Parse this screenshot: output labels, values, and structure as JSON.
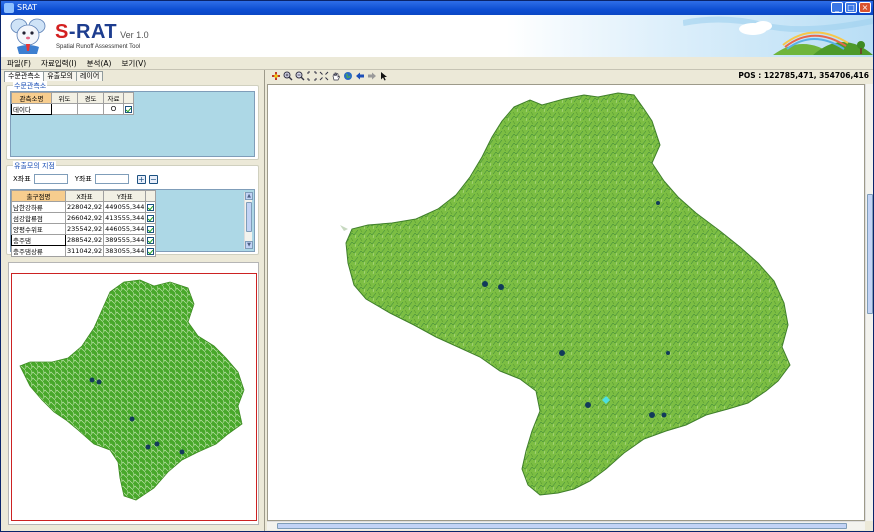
{
  "window": {
    "title": "SRAT",
    "controls": [
      "_",
      "□",
      "×"
    ]
  },
  "banner": {
    "brand_s": "S",
    "brand_rest": "-RAT",
    "version": "Ver 1.0",
    "subtitle": "Spatial Runoff Assessment Tool"
  },
  "menu": [
    "파일(F)",
    "자료입력(I)",
    "분석(A)",
    "보기(V)"
  ],
  "tabs": [
    "수문관측소",
    "유출모의",
    "레이어"
  ],
  "stations": {
    "group_title": "수문관측소",
    "headers": [
      "관측소명",
      "위도",
      "경도",
      "자료"
    ],
    "rows": [
      {
        "name": "데이다",
        "lat": "",
        "lon": "",
        "data": "O",
        "checked": true
      }
    ]
  },
  "outlets": {
    "group_title": "유출모의 지점",
    "x_label": "X좌표",
    "y_label": "Y좌표",
    "x_value": "",
    "y_value": "",
    "add": "+",
    "remove": "−",
    "headers": [
      "출구점명",
      "X좌표",
      "Y좌표"
    ],
    "rows": [
      {
        "name": "남한강하류",
        "x": "228042,92",
        "y": "449055,344",
        "checked": true
      },
      {
        "name": "섬강합류점",
        "x": "266042,92",
        "y": "413555,344",
        "checked": true
      },
      {
        "name": "양평수위표",
        "x": "235542,92",
        "y": "446055,344",
        "checked": true
      },
      {
        "name": "충주댐",
        "x": "288542,92",
        "y": "389555,344",
        "checked": true
      },
      {
        "name": "충주댐상류",
        "x": "311042,92",
        "y": "383055,344",
        "checked": true
      }
    ]
  },
  "toolbar": {
    "icons": [
      "add-layer-icon",
      "zoom-in-icon",
      "zoom-out-icon",
      "zoom-extent-icon",
      "full-extent-icon",
      "pan-hand-icon",
      "globe-icon",
      "back-arrow-icon",
      "forward-arrow-icon",
      "select-pointer-icon"
    ],
    "position": "POS : 122785,471, 354706,416"
  },
  "colors": {
    "basin_fill": "#7cbe43",
    "basin_dark": "#4a8d2a",
    "stream": "#1f6a8a",
    "minimap_fill": "#48a82a",
    "outlet_point": "#123a5a",
    "highlight_point": "#4de0e0",
    "frame_red": "#cc2222"
  }
}
